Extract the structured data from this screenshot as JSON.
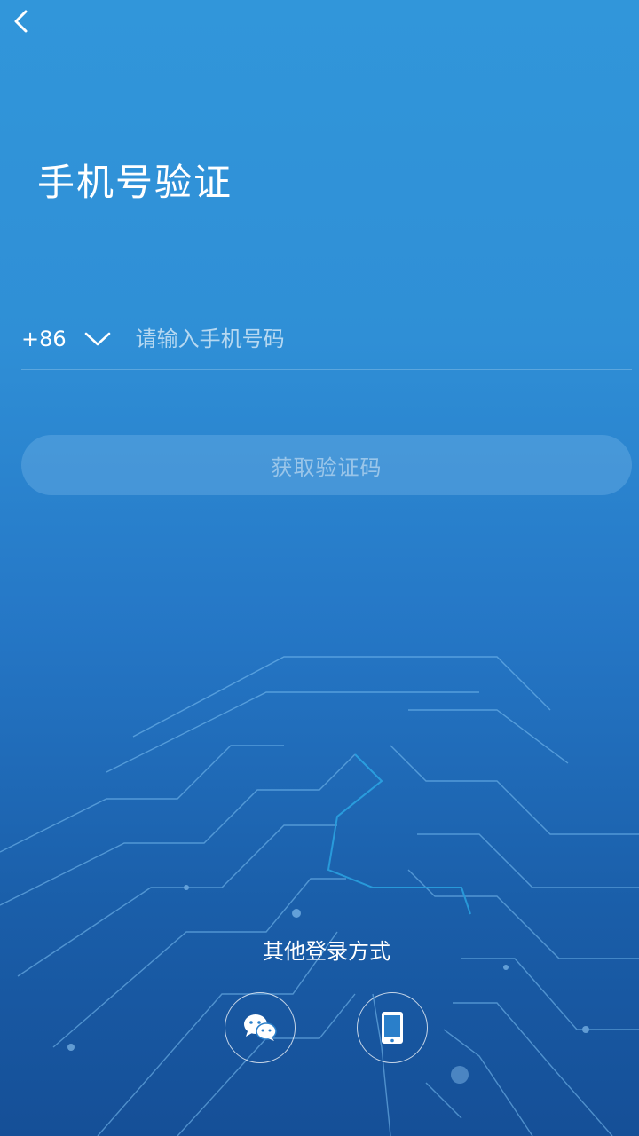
{
  "header": {
    "back_icon": "chevron-left-icon",
    "title": "手机号验证"
  },
  "phone_form": {
    "country_code": "+86",
    "country_dropdown_icon": "chevron-down-icon",
    "phone_placeholder": "请输入手机号码",
    "phone_value": ""
  },
  "get_code_button": {
    "label": "获取验证码",
    "enabled": false
  },
  "other_login": {
    "label": "其他登录方式",
    "options": [
      {
        "name": "wechat",
        "icon": "wechat-icon"
      },
      {
        "name": "phone",
        "icon": "mobile-phone-icon"
      }
    ]
  },
  "colors": {
    "background_top": "#3196da",
    "background_bottom": "#154f97",
    "text": "#ffffff"
  }
}
